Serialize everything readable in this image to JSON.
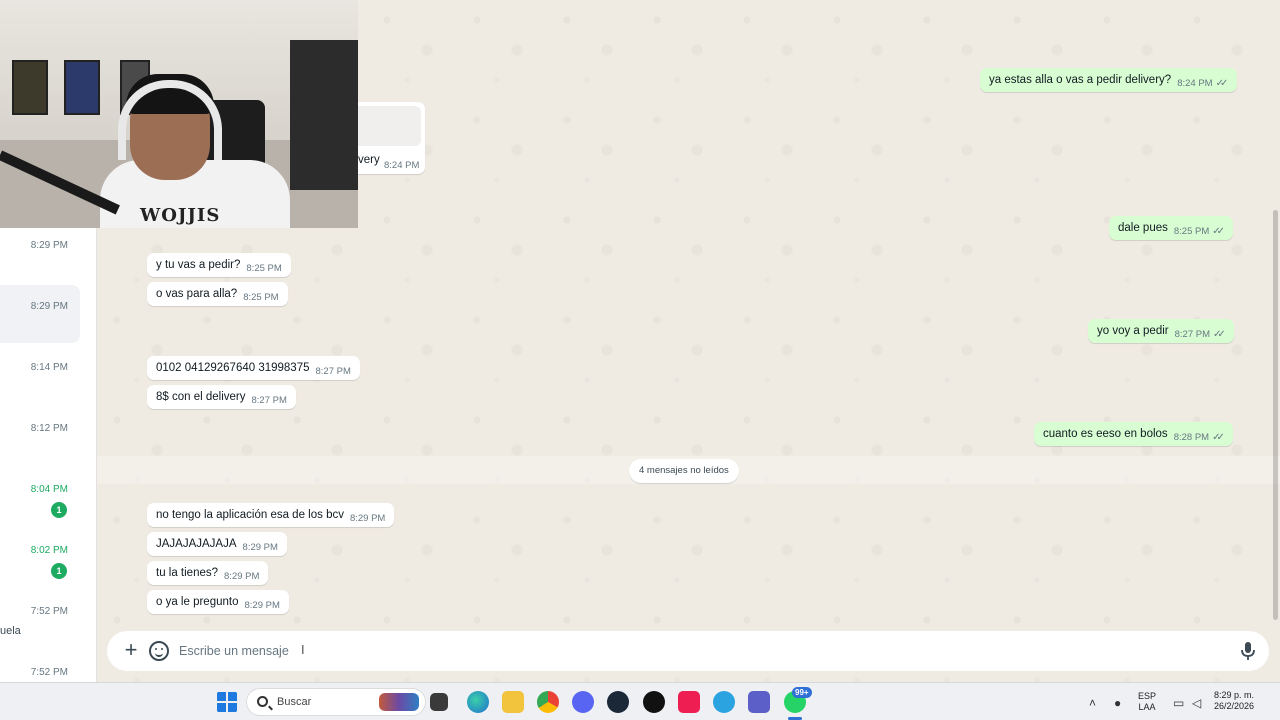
{
  "chat_list": {
    "items": [
      {
        "time": "8:29 PM",
        "unread": false,
        "badge": ""
      },
      {
        "time": "8:29 PM",
        "unread": false,
        "badge": ""
      },
      {
        "time": "8:14 PM",
        "unread": false,
        "badge": ""
      },
      {
        "time": "8:12 PM",
        "unread": false,
        "badge": ""
      },
      {
        "time": "8:04 PM",
        "unread": true,
        "badge": "1"
      },
      {
        "time": "8:02 PM",
        "unread": true,
        "badge": "1"
      },
      {
        "time": "7:52 PM",
        "unread": false,
        "badge": ""
      },
      {
        "time": "7:52 PM",
        "unread": false,
        "badge": ""
      }
    ],
    "fragment_text": "uela"
  },
  "conversation": {
    "partial_message": {
      "text": "very",
      "time": "8:24 PM"
    },
    "outgoing": [
      {
        "text": "ya estas alla o vas a pedir delivery?",
        "time": "8:24 PM"
      },
      {
        "text": "dale pues",
        "time": "8:25 PM"
      },
      {
        "text": "yo voy a pedir",
        "time": "8:27 PM"
      },
      {
        "text": "cuanto es eeso en bolos",
        "time": "8:28 PM"
      }
    ],
    "incoming": [
      {
        "text": "y tu vas a pedir?",
        "time": "8:25 PM"
      },
      {
        "text": "o vas para alla?",
        "time": "8:25 PM"
      },
      {
        "text": "0102 04129267640 31998375",
        "time": "8:27 PM"
      },
      {
        "text": "8$ con el delivery",
        "time": "8:27 PM"
      },
      {
        "text": "no tengo la aplicación esa de los bcv",
        "time": "8:29 PM"
      },
      {
        "text": "JAJAJAJAJAJA",
        "time": "8:29 PM"
      },
      {
        "text": "tu la tienes?",
        "time": "8:29 PM"
      },
      {
        "text": "o ya le pregunto",
        "time": "8:29 PM"
      }
    ],
    "unread_divider": "4 mensajes no leídos",
    "read_tick": "✓✓"
  },
  "composer": {
    "placeholder": "Escribe un mensaje",
    "value": "",
    "plus_icon": "plus-icon",
    "sticker_icon": "sticker-icon",
    "mic_icon": "microphone-icon"
  },
  "taskbar": {
    "search_label": "Buscar",
    "badge": "99+",
    "lang_top": "ESP",
    "lang_bottom": "LAA",
    "clock_time": "8:29 p. m.",
    "clock_date": "26/2/2026"
  },
  "webcam": {
    "shirt_print": "WOJJIS"
  },
  "colors": {
    "outgoing_bubble": "#d9fdd3",
    "incoming_bubble": "#ffffff",
    "chat_background": "#efeae2",
    "unread_accent": "#1daa61",
    "tick": "#667781"
  }
}
